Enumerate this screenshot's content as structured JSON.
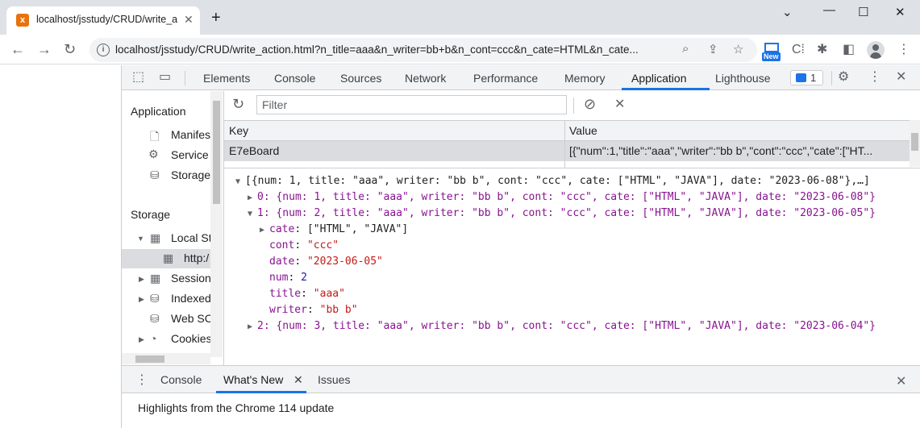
{
  "browser": {
    "tab_title": "localhost/jsstudy/CRUD/write_ac",
    "tab_favicon_letter": "x",
    "url": "localhost/jsstudy/CRUD/write_action.html?n_title=aaa&n_writer=bb+b&n_cont=ccc&n_cate=HTML&n_cate...",
    "new_badge": "New"
  },
  "devtools": {
    "tabs": [
      "Elements",
      "Console",
      "Sources",
      "Network",
      "Performance",
      "Memory",
      "Application",
      "Lighthouse"
    ],
    "active_tab": "Application",
    "issues_count": "1"
  },
  "sidebar": {
    "application_header": "Application",
    "application_items": [
      "Manifest",
      "Service",
      "Storage"
    ],
    "storage_header": "Storage",
    "storage_items": [
      "Local St",
      "http:/",
      "Session",
      "Indexed",
      "Web SC",
      "Cookies"
    ]
  },
  "storage_table": {
    "filter_placeholder": "Filter",
    "columns": [
      "Key",
      "Value"
    ],
    "rows": [
      {
        "key": "E7eBoard",
        "value": "[{\"num\":1,\"title\":\"aaa\",\"writer\":\"bb b\",\"cont\":\"ccc\",\"cate\":[\"HT..."
      }
    ]
  },
  "preview": {
    "root": "[{num: 1, title: \"aaa\", writer: \"bb b\", cont: \"ccc\", cate: [\"HTML\", \"JAVA\"], date: \"2023-06-08\"},…]",
    "item0": "0: {num: 1, title: \"aaa\", writer: \"bb b\", cont: \"ccc\", cate: [\"HTML\", \"JAVA\"], date: \"2023-06-08\"}",
    "item1": "1: {num: 2, title: \"aaa\", writer: \"bb b\", cont: \"ccc\", cate: [\"HTML\", \"JAVA\"], date: \"2023-06-05\"}",
    "item1_fields": {
      "cate_key": "cate",
      "cate_val": "[\"HTML\", \"JAVA\"]",
      "cont_key": "cont",
      "cont_val": "\"ccc\"",
      "date_key": "date",
      "date_val": "\"2023-06-05\"",
      "num_key": "num",
      "num_val": "2",
      "title_key": "title",
      "title_val": "\"aaa\"",
      "writer_key": "writer",
      "writer_val": "\"bb b\""
    },
    "item2": "2: {num: 3, title: \"aaa\", writer: \"bb b\", cont: \"ccc\", cate: [\"HTML\", \"JAVA\"], date: \"2023-06-04\"}"
  },
  "drawer": {
    "tabs": [
      "Console",
      "What's New",
      "Issues"
    ],
    "active_tab": "What's New",
    "message": "Highlights from the Chrome 114 update"
  },
  "colors": {
    "accent": "#1a73e8",
    "key_purple": "#881391",
    "string_red": "#c41a16",
    "number_blue": "#1a1aa6"
  }
}
